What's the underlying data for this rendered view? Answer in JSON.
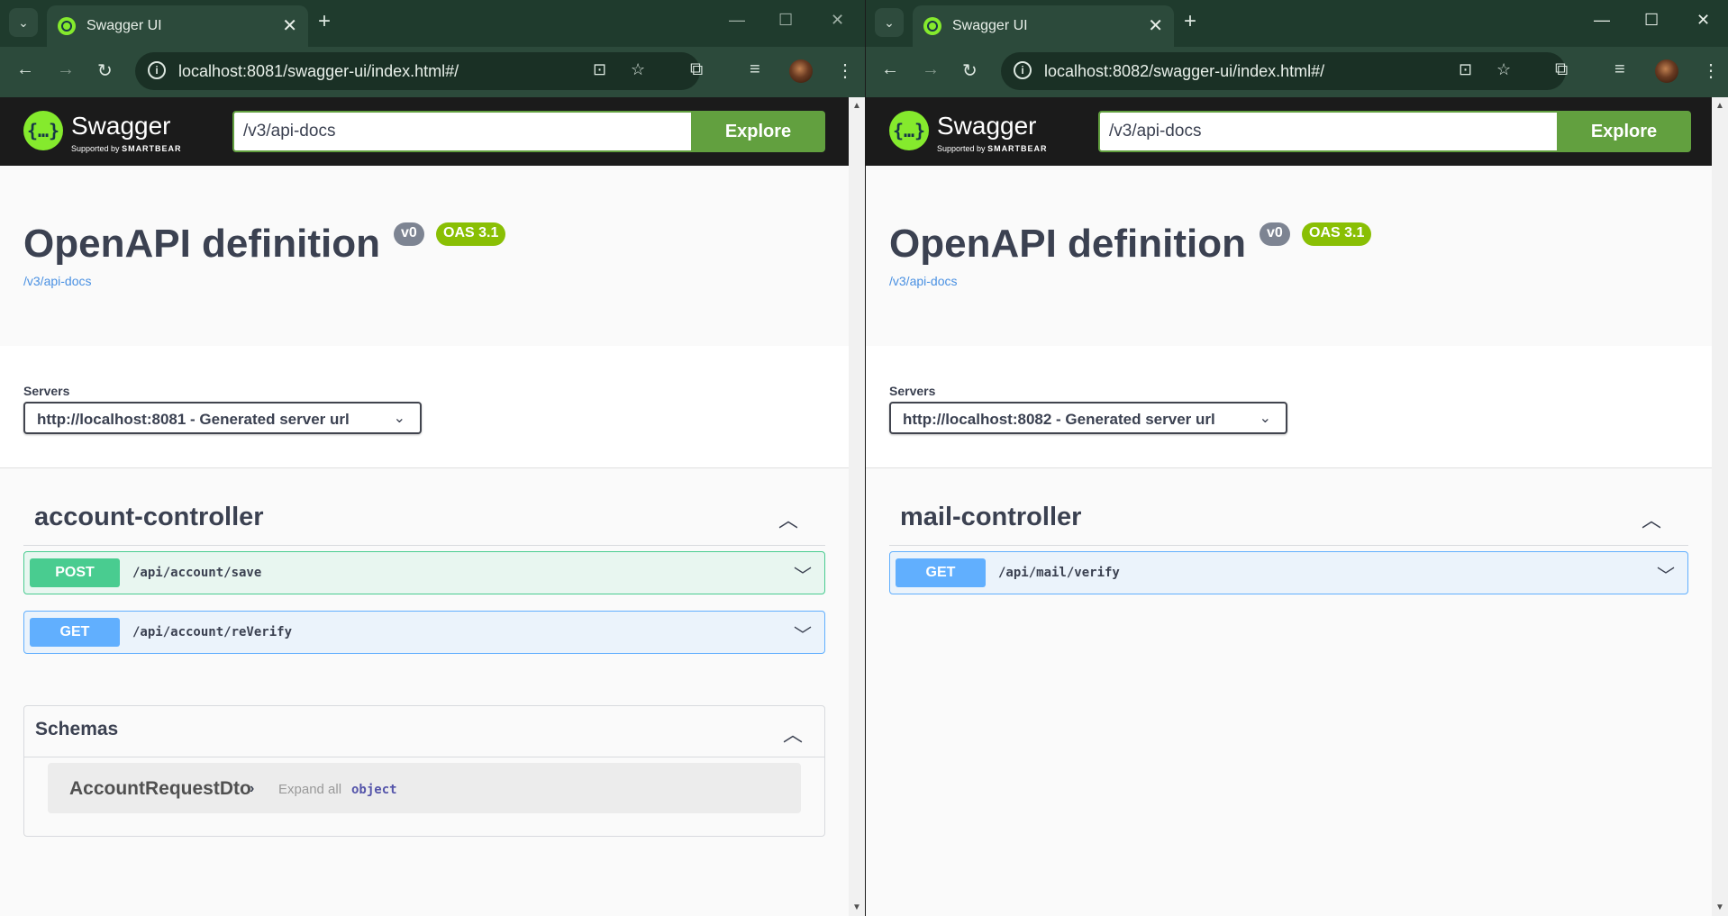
{
  "left": {
    "tab_title": "Swagger UI",
    "url": "localhost:8081/swagger-ui/index.html#/",
    "swagger": {
      "brand": "Swagger",
      "sub_prefix": "Supported by",
      "sub_brand": "SMARTBEAR",
      "spec_url": "/v3/api-docs",
      "explore_label": "Explore"
    },
    "info": {
      "title": "OpenAPI definition",
      "version_badge": "v0",
      "oas_badge": "OAS 3.1",
      "link": "/v3/api-docs"
    },
    "servers": {
      "label": "Servers",
      "selected": "http://localhost:8081 - Generated server url"
    },
    "tag": {
      "name": "account-controller"
    },
    "operations": [
      {
        "method": "POST",
        "path": "/api/account/save"
      },
      {
        "method": "GET",
        "path": "/api/account/reVerify"
      }
    ],
    "schemas": {
      "title": "Schemas",
      "model_name": "AccountRequestDto",
      "expand_label": "Expand all",
      "model_type": "object"
    }
  },
  "right": {
    "tab_title": "Swagger UI",
    "url": "localhost:8082/swagger-ui/index.html#/",
    "swagger": {
      "brand": "Swagger",
      "sub_prefix": "Supported by",
      "sub_brand": "SMARTBEAR",
      "spec_url": "/v3/api-docs",
      "explore_label": "Explore"
    },
    "info": {
      "title": "OpenAPI definition",
      "version_badge": "v0",
      "oas_badge": "OAS 3.1",
      "link": "/v3/api-docs"
    },
    "servers": {
      "label": "Servers",
      "selected": "http://localhost:8082 - Generated server url"
    },
    "tag": {
      "name": "mail-controller"
    },
    "operations": [
      {
        "method": "GET",
        "path": "/api/mail/verify"
      }
    ]
  },
  "colors": {
    "post": "#49cc90",
    "get": "#61affe",
    "swagger_green": "#85ea2d",
    "explore": "#62a03f",
    "chrome_dark": "#1f3b2d",
    "chrome_toolbar": "#2c4a3b"
  }
}
